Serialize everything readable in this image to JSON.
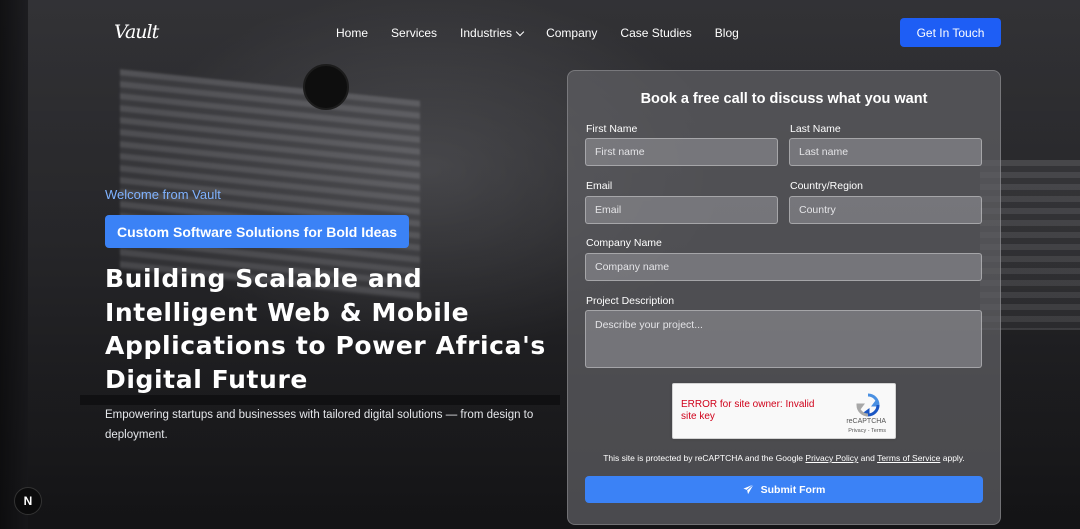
{
  "brand": {
    "logo_text": "Vault"
  },
  "nav": {
    "items": [
      {
        "label": "Home"
      },
      {
        "label": "Services"
      },
      {
        "label": "Industries"
      },
      {
        "label": "Company"
      },
      {
        "label": "Case Studies"
      },
      {
        "label": "Blog"
      }
    ],
    "cta_label": "Get In Touch"
  },
  "hero": {
    "welcome": "Welcome from Vault",
    "pill": "Custom Software Solutions for Bold Ideas",
    "headline": "Building Scalable and Intelligent Web & Mobile Applications to Power Africa's Digital Future",
    "subtext": "Empowering startups and businesses with tailored digital solutions — from design to deployment."
  },
  "form": {
    "title": "Book a free call to discuss what you want",
    "first_name": {
      "label": "First Name",
      "placeholder": "First name"
    },
    "last_name": {
      "label": "Last Name",
      "placeholder": "Last name"
    },
    "email": {
      "label": "Email",
      "placeholder": "Email"
    },
    "country": {
      "label": "Country/Region",
      "placeholder": "Country"
    },
    "company": {
      "label": "Company Name",
      "placeholder": "Company name"
    },
    "description": {
      "label": "Project Description",
      "placeholder": "Describe your project..."
    },
    "recaptcha": {
      "error": "ERROR for site owner: Invalid site key",
      "brand": "reCAPTCHA",
      "terms": "Privacy - Terms"
    },
    "protected_text": {
      "prefix": "This site is protected by reCAPTCHA and the Google ",
      "privacy": "Privacy Policy",
      "and": " and ",
      "terms": "Terms of Service",
      "suffix": " apply."
    },
    "submit_label": "Submit Form"
  },
  "badge": {
    "letter": "N"
  },
  "colors": {
    "accent": "#1e5ef5",
    "pill": "#3b82f6",
    "welcome": "#7fb2ff",
    "error": "#d0021b"
  }
}
